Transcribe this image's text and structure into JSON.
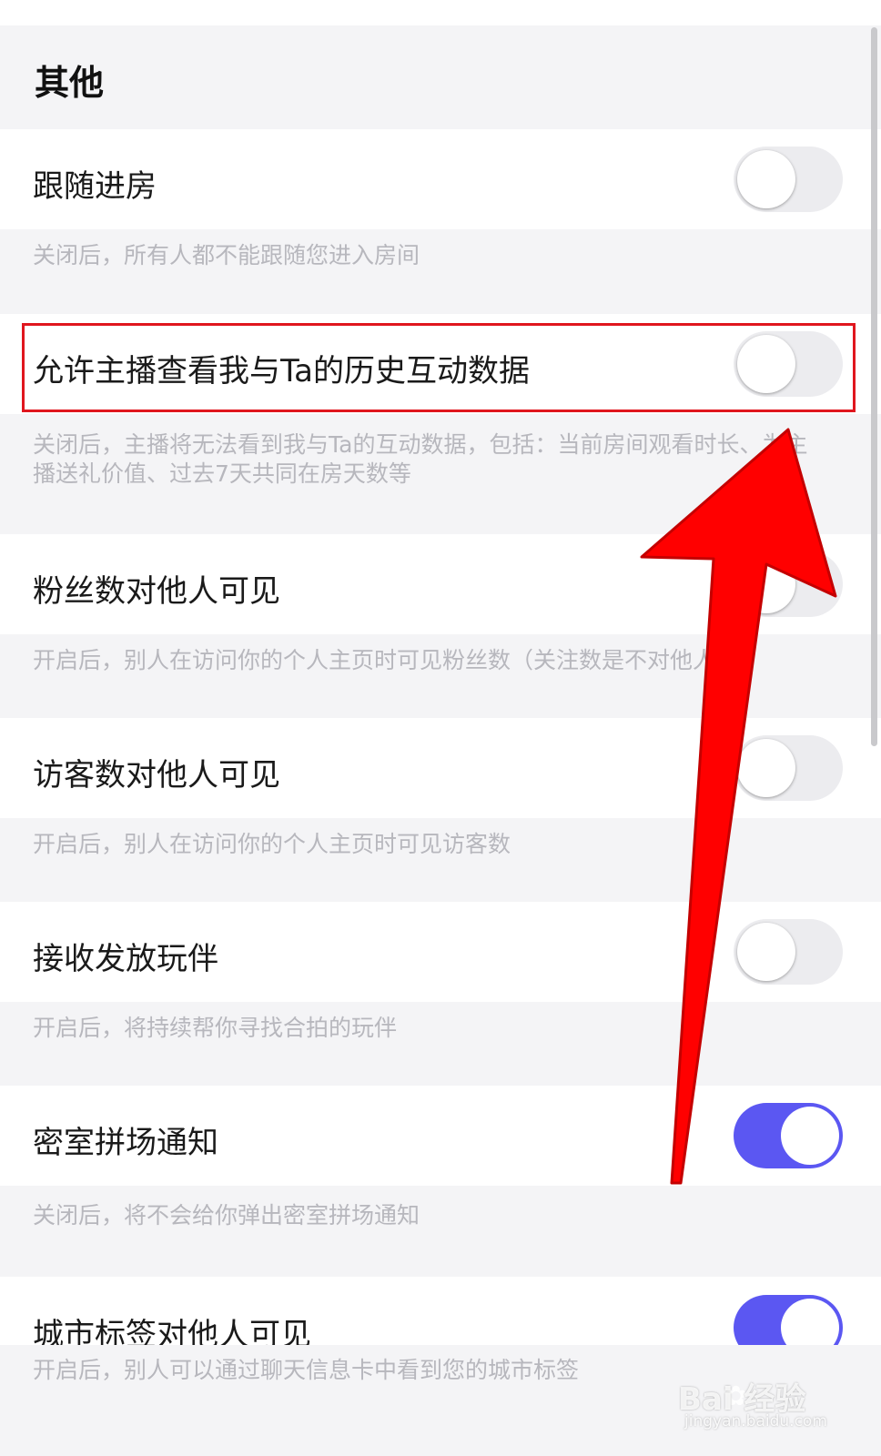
{
  "section": {
    "title": "其他"
  },
  "settings": [
    {
      "label": "跟随进房",
      "desc": "关闭后，所有人都不能跟随您进入房间",
      "enabled": false
    },
    {
      "label": "允许主播查看我与Ta的历史互动数据",
      "desc": "关闭后，主播将无法看到我与Ta的互动数据，包括：当前房间观看时长、为主播送礼价值、过去7天共同在房天数等",
      "enabled": false
    },
    {
      "label": "粉丝数对他人可见",
      "desc": "开启后，别人在访问你的个人主页时可见粉丝数（关注数是不对他人…",
      "enabled": false
    },
    {
      "label": "访客数对他人可见",
      "desc": "开启后，别人在访问你的个人主页时可见访客数",
      "enabled": false
    },
    {
      "label": "接收发放玩伴",
      "desc": "开启后，将持续帮你寻找合拍的玩伴",
      "enabled": false
    },
    {
      "label": "密室拼场通知",
      "desc": "关闭后，将不会给你弹出密室拼场通知",
      "enabled": true
    },
    {
      "label": "城市标签对他人可见",
      "desc": "开启后，别人可以通过聊天信息卡中看到您的城市标签",
      "enabled": true
    }
  ],
  "watermark": {
    "brand": "Bai 经验",
    "url": "jingyan.baidu.com"
  },
  "colors": {
    "toggle_on": "#5b57f2",
    "toggle_off": "#ececef",
    "highlight": "#e0161e",
    "arrow": "#ff0000"
  }
}
